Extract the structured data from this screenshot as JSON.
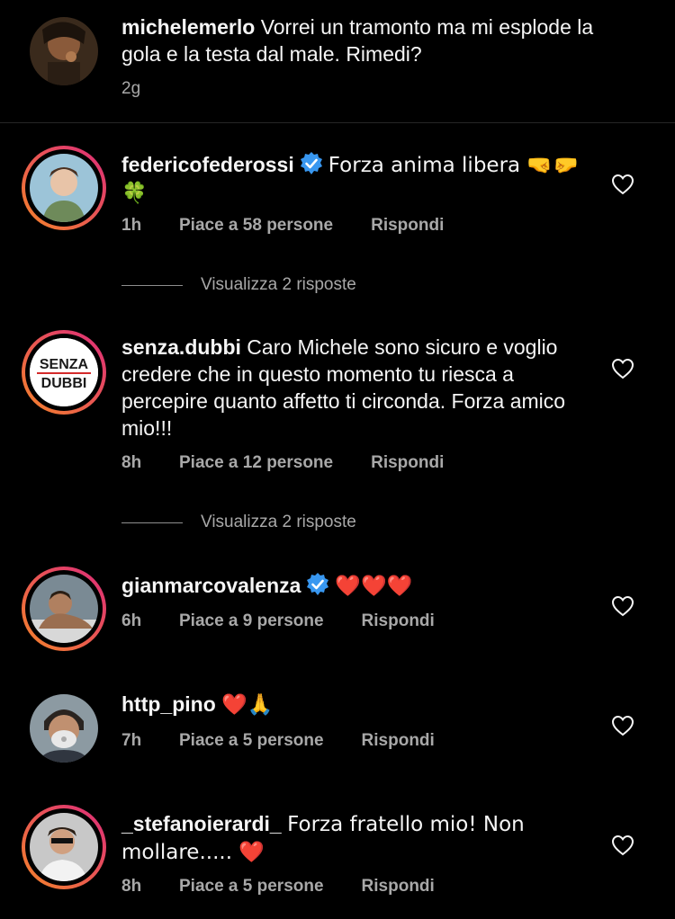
{
  "caption": {
    "username": "michelemerlo",
    "text": "Vorrei un tramonto ma mi esplode la gola e la testa dal male. Rimedi?",
    "time": "2g"
  },
  "comments": [
    {
      "username": "federicofederossi",
      "verified": true,
      "text": "Forza anima libera 🤜🤛 🍀",
      "time": "1h",
      "likes": "Piace a 58 persone",
      "reply": "Rispondi",
      "view_replies": "Visualizza 2 risposte"
    },
    {
      "username": "senza.dubbi",
      "verified": false,
      "text": "Caro Michele sono sicuro e voglio credere che in questo momento tu riesca a  percepire quanto affetto ti circonda. Forza amico mio!!!",
      "time": "8h",
      "likes": "Piace a 12 persone",
      "reply": "Rispondi",
      "view_replies": "Visualizza 2 risposte",
      "avatar_text_top": "SENZA",
      "avatar_text_bottom": "DUBBI"
    },
    {
      "username": "gianmarcovalenza",
      "verified": true,
      "text": "❤️❤️❤️",
      "time": "6h",
      "likes": "Piace a 9 persone",
      "reply": "Rispondi"
    },
    {
      "username": "http_pino",
      "verified": false,
      "text": "❤️🙏",
      "time": "7h",
      "likes": "Piace a 5 persone",
      "reply": "Rispondi"
    },
    {
      "username": "_stefanoierardi_",
      "verified": false,
      "text": "Forza fratello mio! Non mollare..... ❤️",
      "time": "8h",
      "likes": "Piace a 5 persone",
      "reply": "Rispondi"
    }
  ],
  "colors": {
    "background": "#000000",
    "text": "#f5f5f5",
    "secondary": "#a8a8a8",
    "verified_blue": "#3897f0",
    "heart_red": "#ed4956",
    "story_ring_start": "#f58529",
    "story_ring_end": "#dd2a7b"
  },
  "icons": {
    "like": "heart-outline-icon",
    "verified": "verified-badge-icon"
  }
}
